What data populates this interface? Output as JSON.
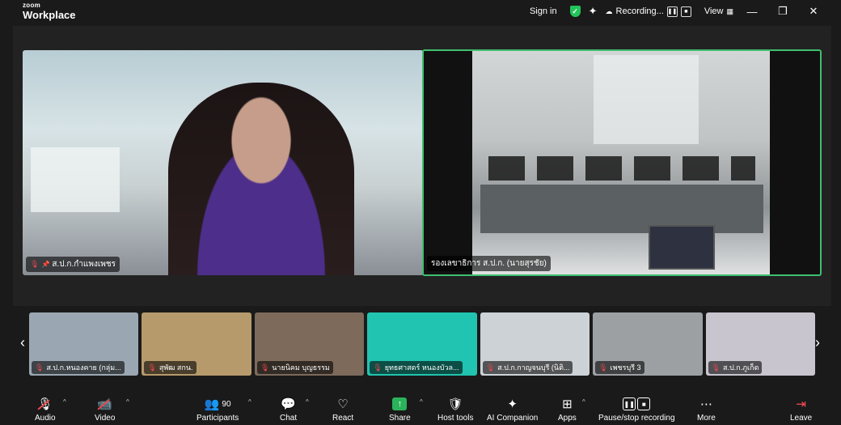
{
  "app": {
    "logo_top": "zoom",
    "logo_bottom": "Workplace"
  },
  "titlebar": {
    "sign_in": "Sign in",
    "recording_label": "Recording...",
    "view_label": "View"
  },
  "stage": {
    "left_tile_name": "ส.ป.ก.กำแพงเพชร",
    "right_tile_name": "รองเลขาธิการ ส.ป.ก. (นายสุรชัย)"
  },
  "gallery": {
    "thumbs": [
      {
        "name": "ส.ป.ก.หนองคาย (กลุ่ม...",
        "bg": "#9aa7b2"
      },
      {
        "name": "สุพัฒ สกน.",
        "bg": "#b79a6c"
      },
      {
        "name": "นายนิคม บุญธรรม",
        "bg": "#7d6a5b"
      },
      {
        "name": "ยุทธศาสตร์ หนองบัวล...",
        "bg": "#20c4b0"
      },
      {
        "name": "ส.ป.ก.กาญจนบุรี (นิติ...",
        "bg": "#cdd2d6"
      },
      {
        "name": "เพชรบุรี 3",
        "bg": "#9da0a3"
      },
      {
        "name": "ส.ป.ก.ภูเก็ต",
        "bg": "#c9c5cf"
      }
    ]
  },
  "toolbar": {
    "audio": "Audio",
    "video": "Video",
    "participants": "Participants",
    "participants_count": "90",
    "chat": "Chat",
    "react": "React",
    "share": "Share",
    "host_tools": "Host tools",
    "ai_companion": "AI Companion",
    "apps": "Apps",
    "pause_recording": "Pause/stop recording",
    "more": "More",
    "leave": "Leave"
  }
}
